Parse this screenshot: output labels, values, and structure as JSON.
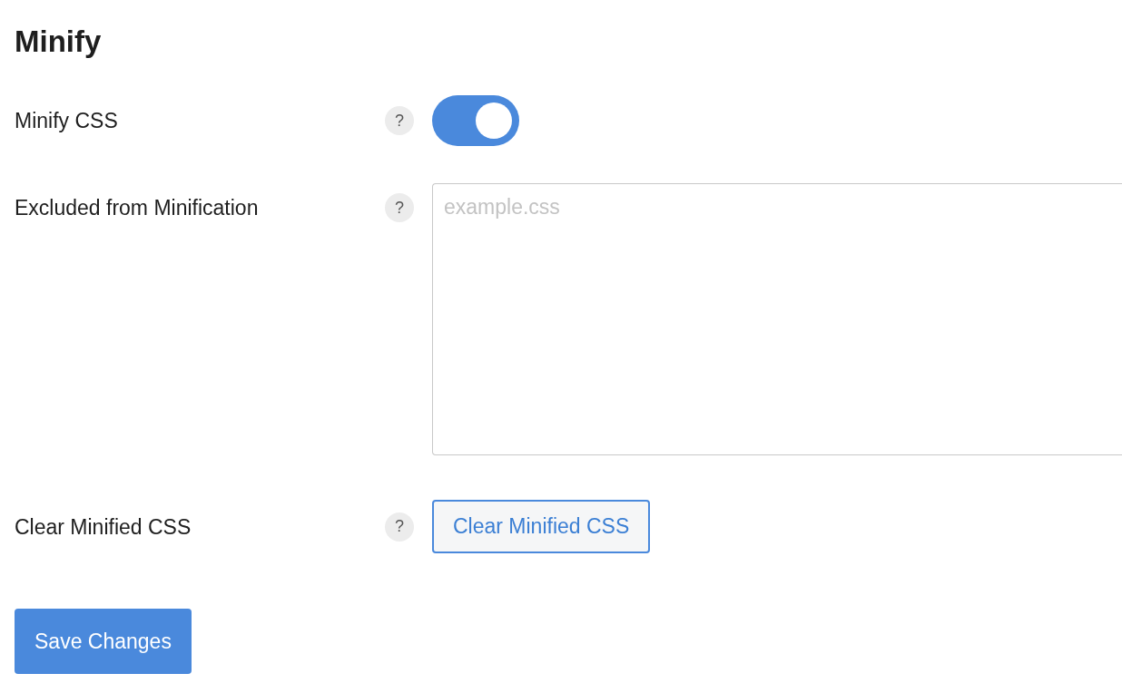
{
  "title": "Minify",
  "settings": [
    {
      "kind": "toggle",
      "label": "Minify CSS",
      "help": "?",
      "on": true
    },
    {
      "kind": "textarea",
      "label": "Excluded from Minification",
      "help": "?",
      "placeholder": "example.css"
    },
    {
      "kind": "button",
      "label": "Clear Minified CSS",
      "help": "?",
      "button": "Clear Minified CSS"
    }
  ],
  "save_button": "Save Changes"
}
